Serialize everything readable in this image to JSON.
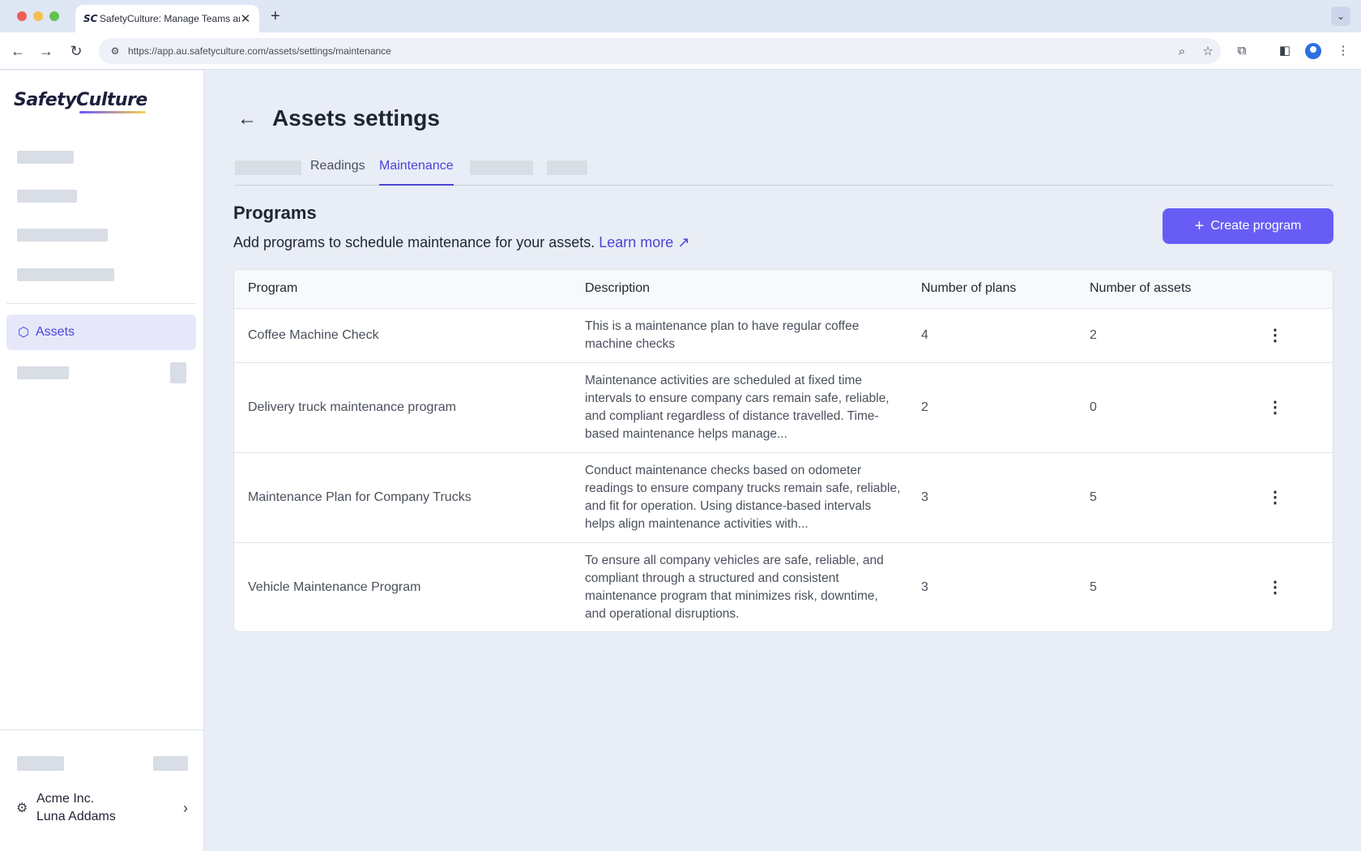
{
  "browser": {
    "tab_title": "SafetyCulture: Manage Teams and...",
    "tab_favicon": "SC",
    "url": "https://app.au.safetyculture.com/assets/settings/maintenance"
  },
  "sidebar": {
    "logo": "SafetyCulture",
    "active_item": "Assets",
    "org_name": "Acme Inc.",
    "user_name": "Luna Addams"
  },
  "page": {
    "title": "Assets settings",
    "tabs": [
      "Readings",
      "Maintenance"
    ],
    "active_tab": "Maintenance",
    "section_title": "Programs",
    "section_desc": "Add programs to schedule maintenance for your assets.",
    "learn_more": "Learn more",
    "create_button": "Create program"
  },
  "table": {
    "headers": [
      "Program",
      "Description",
      "Number of plans",
      "Number of assets"
    ],
    "rows": [
      {
        "program": "Coffee Machine Check",
        "description": "This is a maintenance plan to have regular coffee machine checks",
        "plans": "4",
        "assets": "2"
      },
      {
        "program": "Delivery truck maintenance program",
        "description": "Maintenance activities are scheduled at fixed time intervals to ensure company cars remain safe, reliable, and compliant regardless of distance travelled. Time-based maintenance helps manage...",
        "plans": "2",
        "assets": "0"
      },
      {
        "program": "Maintenance Plan for Company Trucks",
        "description": "Conduct maintenance checks based on odometer readings to ensure company trucks remain safe, reliable, and fit for operation. Using distance-based intervals helps align maintenance activities with...",
        "plans": "3",
        "assets": "5"
      },
      {
        "program": "Vehicle Maintenance Program",
        "description": "To ensure all company vehicles are safe, reliable, and compliant through a structured and consistent maintenance program that minimizes risk, downtime, and operational disruptions.",
        "plans": "3",
        "assets": "5"
      }
    ]
  },
  "colors": {
    "accent": "#4b44d6",
    "button": "#675df4",
    "background": "#e9edf6"
  }
}
